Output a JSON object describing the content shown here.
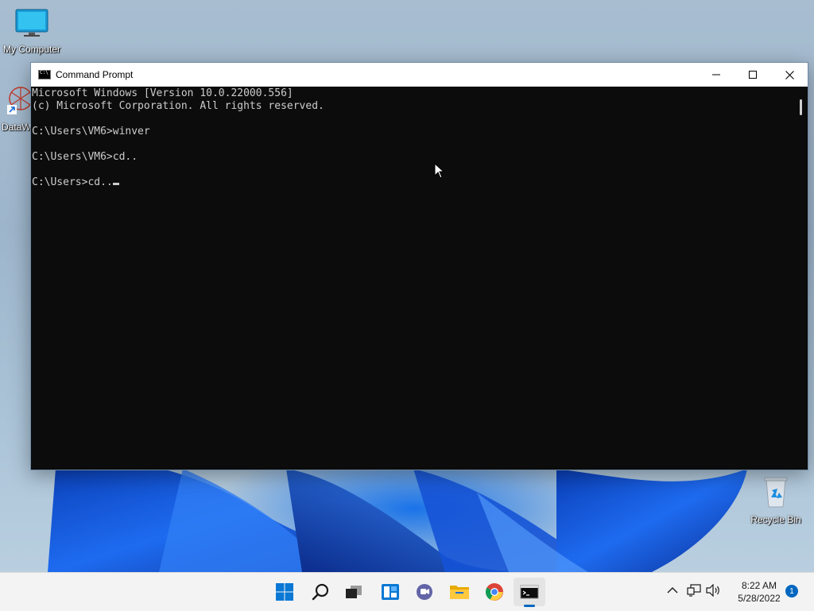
{
  "desktop": {
    "icons": [
      {
        "label": "My Computer",
        "icon": "monitor-icon"
      },
      {
        "label": "DataW",
        "icon": "datawrapper-shortcut-icon"
      },
      {
        "label": "Recycle Bin",
        "icon": "recycle-bin-icon"
      }
    ]
  },
  "window": {
    "title": "Command Prompt",
    "icon": "cmd-icon",
    "controls": [
      "minimize-icon",
      "maximize-icon",
      "close-icon"
    ]
  },
  "console": {
    "lines": [
      "Microsoft Windows [Version 10.0.22000.556]",
      "(c) Microsoft Corporation. All rights reserved.",
      "",
      "C:\\Users\\VM6>winver",
      "",
      "C:\\Users\\VM6>cd..",
      "",
      "C:\\Users>cd.."
    ]
  },
  "taskbar": {
    "apps": [
      "start-icon",
      "search-icon",
      "task-view-icon",
      "widgets-icon",
      "chat-icon",
      "file-explorer-icon",
      "chrome-icon",
      "command-prompt-icon"
    ],
    "tray": [
      "chevron-up-icon",
      "network-icon",
      "volume-icon"
    ],
    "time": "8:22 AM",
    "date": "5/28/2022",
    "notification_count": "1"
  },
  "colors": {
    "console_bg": "#0c0c0c",
    "console_fg": "#cccccc",
    "accent": "#0067c0"
  }
}
